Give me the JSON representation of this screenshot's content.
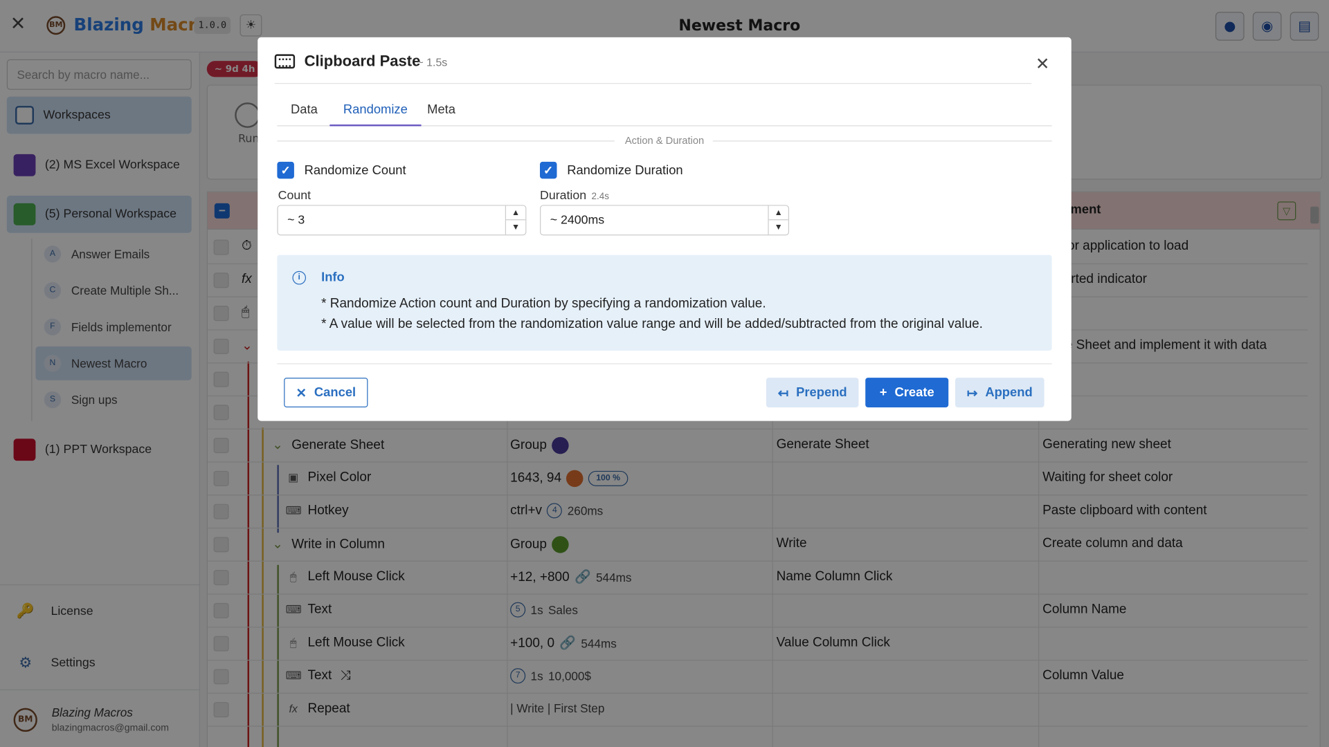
{
  "header": {
    "app_name_a": "Blazing ",
    "app_name_b": "Macros",
    "logo_text": "BM",
    "version": "1.0.0",
    "page_title": "Newest Macro"
  },
  "sidebar": {
    "search_placeholder": "Search by macro name...",
    "workspaces_label": "Workspaces",
    "workspaces": [
      {
        "label": "(2) MS Excel Workspace",
        "color": "#6a3fb5"
      },
      {
        "label": "(5) Personal Workspace",
        "color": "#4caf50"
      },
      {
        "label": "(1) PPT Workspace",
        "color": "#c8102e"
      }
    ],
    "macros": [
      {
        "letter": "A",
        "label": "Answer Emails"
      },
      {
        "letter": "C",
        "label": "Create Multiple Sh..."
      },
      {
        "letter": "F",
        "label": "Fields implementor"
      },
      {
        "letter": "N",
        "label": "Newest Macro"
      },
      {
        "letter": "S",
        "label": "Sign ups"
      }
    ],
    "license": "License",
    "settings": "Settings",
    "user_name": "Blazing Macros",
    "user_email": "blazingmacros@gmail.com"
  },
  "main": {
    "time_badge": "~ 9d 4h",
    "run_label": "Run",
    "comment_header": "ment",
    "rows_top": [
      {
        "comment": "ing for application to load"
      },
      {
        "comment": "o started indicator"
      },
      {
        "comment": ""
      },
      {
        "comment": "erate Sheet and implement it with data"
      }
    ],
    "rows": [
      {
        "name": "Generate Sheet",
        "value": "Group",
        "label": "Generate Sheet",
        "comment": "Generating new sheet",
        "dot": "#4a3a9a"
      },
      {
        "name": "Pixel Color",
        "value": "1643, 94",
        "pct": "100 %",
        "label": "",
        "comment": "Waiting for sheet color",
        "dot": "#e07030"
      },
      {
        "name": "Hotkey",
        "value": "ctrl+v",
        "num": "4",
        "extra": "260ms",
        "label": "",
        "comment": "Paste clipboard with content"
      },
      {
        "name": "Write in Column",
        "value": "Group",
        "label": "Write",
        "comment": "Create column and data",
        "dot": "#5a9a2a"
      },
      {
        "name": "Left Mouse Click",
        "value": "+12, +800",
        "extra": "544ms",
        "label": "Name Column Click",
        "comment": ""
      },
      {
        "name": "Text",
        "num": "5",
        "value": "1s",
        "extra": "Sales",
        "label": "",
        "comment": "Column Name"
      },
      {
        "name": "Left Mouse Click",
        "value": "+100, 0",
        "extra": "544ms",
        "label": "Value Column Click",
        "comment": ""
      },
      {
        "name": "Text",
        "num": "7",
        "value": "1s",
        "extra": "10,000$",
        "label": "",
        "comment": "Column Value"
      },
      {
        "name": "Repeat",
        "value": "| Write | First Step",
        "label": "",
        "comment": ""
      }
    ]
  },
  "modal": {
    "title": "Clipboard Paste",
    "subtitle": "~ 1.5s",
    "tabs": [
      "Data",
      "Randomize",
      "Meta"
    ],
    "section": "Action & Duration",
    "randomize_count": "Randomize Count",
    "randomize_duration": "Randomize Duration",
    "count_label": "Count",
    "count_value": "~  3",
    "duration_label": "Duration",
    "duration_hint": "2.4s",
    "duration_value": "~  2400ms",
    "info_title": "Info",
    "info_line1": "* Randomize Action count and Duration by specifying a randomization value.",
    "info_line2": "* A value will be selected from the randomization value range and will be added/subtracted from the original value.",
    "cancel": "Cancel",
    "prepend": "Prepend",
    "create": "Create",
    "append": "Append"
  }
}
